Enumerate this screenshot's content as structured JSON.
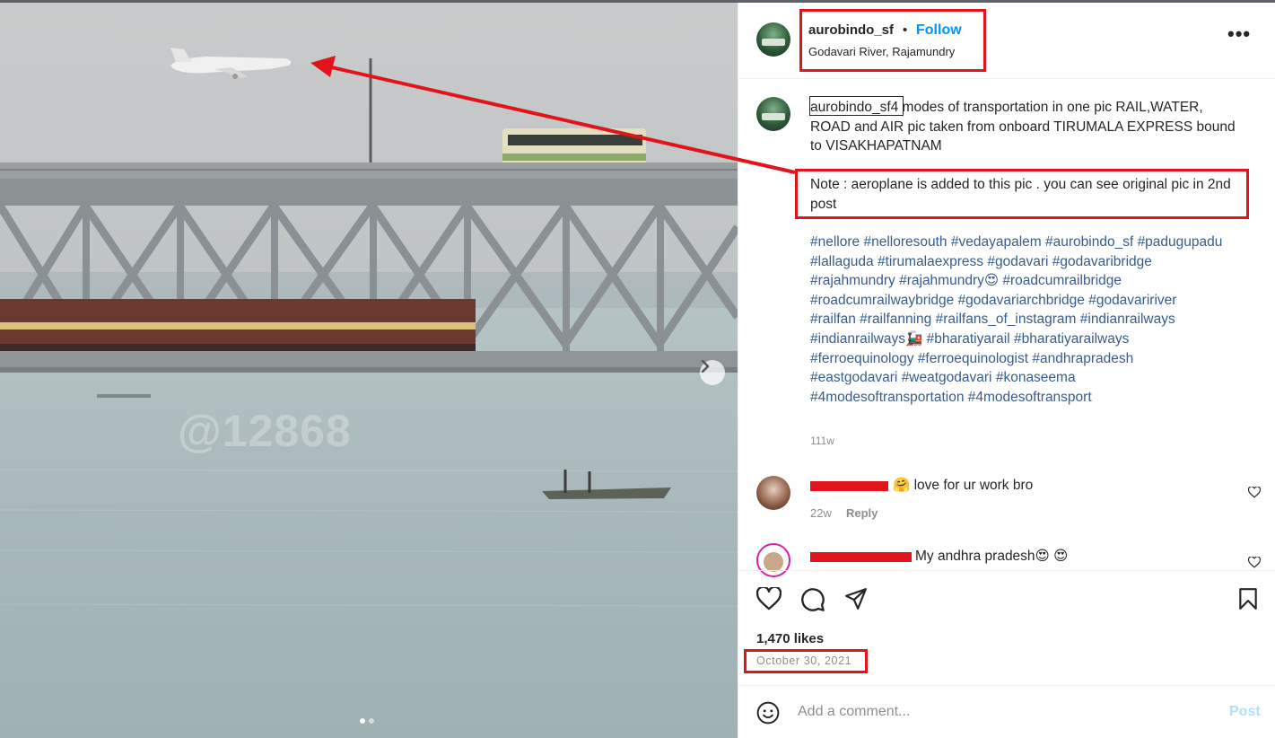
{
  "post": {
    "username": "aurobindo_sf",
    "separator": "•",
    "follow_label": "Follow",
    "location": "Godavari River, Rajamundry",
    "more_label": "•••",
    "caption_username": "aurobindo_sf",
    "caption_text": "4 modes of transportation in one pic RAIL,WATER, ROAD and AIR pic taken from onboard TIRUMALA EXPRESS bound to VISAKHAPATNAM",
    "note": "Note : aeroplane is added to this pic . you can see original pic in 2nd post",
    "hashtags": [
      "#nellore",
      "#nelloresouth",
      "#vedayapalem",
      "#aurobindo_sf",
      "#padugupadu",
      "#lallaguda",
      "#tirumalaexpress",
      "#godavari",
      "#godavaribridge",
      "#rajahmundry",
      "#rajahmundry😍",
      "#roadcumrailbridge",
      "#roadcumrailwaybridge",
      "#godavariarchbridge",
      "#godavaririver",
      "#railfan",
      "#railfanning",
      "#railfans_of_instagram",
      "#indianrailways",
      "#indianrailways🚂",
      "#bharatiyarail",
      "#bharatiyarailways",
      "#ferroequinology",
      "#ferroequinologist",
      "#andhrapradesh",
      "#eastgodavari",
      "#weatgodavari",
      "#konaseema",
      "#4modesoftransportation",
      "#4modesoftransport"
    ],
    "caption_time": "111w",
    "likes": "1,470 likes",
    "date": "October 30, 2021"
  },
  "photo": {
    "watermark": "@12868",
    "carousel_count": 2,
    "carousel_active": 1
  },
  "comments": [
    {
      "text": "🤗 love for ur work bro",
      "time": "22w",
      "reply_label": "Reply"
    },
    {
      "text": "My andhra pradesh😍 😍"
    }
  ],
  "composer": {
    "emoji_label": "☺",
    "placeholder": "Add a comment...",
    "post_label": "Post"
  },
  "colors": {
    "accent": "#0095f6",
    "hashtag": "#385c8e",
    "annotation_red": "#e2141b"
  }
}
